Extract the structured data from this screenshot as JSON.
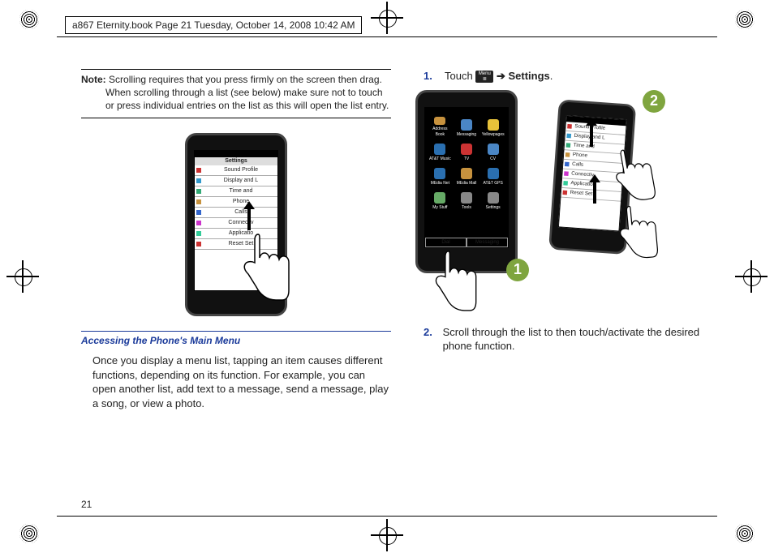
{
  "header": "a867 Eternity.book  Page 21  Tuesday, October 14, 2008  10:42 AM",
  "page_number": "21",
  "note": {
    "label": "Note:",
    "text": "Scrolling requires that you press firmly on the screen then drag. When scrolling through a list (see below) make sure not to touch or press individual entries on the list as this will open the list entry."
  },
  "fig1_phone": {
    "title": "Settings",
    "rows": [
      "Sound Profile",
      "Display and L",
      "Time and",
      "Phone",
      "Calls",
      "Connectiv",
      "Applicatio",
      "Reset Set"
    ]
  },
  "heading": "Accessing the Phone's Main Menu",
  "paragraph": "Once you display a menu list, tapping an item causes different functions, depending on its function. For example, you can open another list, add text to a message, send a message, play a song, or view a photo.",
  "steps": {
    "s1": {
      "num": "1.",
      "pre": "Touch",
      "icon_label": "Menu",
      "arrow": "➔",
      "target": "Settings",
      "tail": "."
    },
    "s2": {
      "num": "2.",
      "text": "Scroll through the list to then touch/activate the desired phone function."
    }
  },
  "fig2_apps": {
    "left": [
      "Address Book",
      "Messaging",
      "Yellowpages",
      "AT&T Music",
      "TV",
      "CV",
      "MEdia Net",
      "MEdia Mall",
      "AT&T GPS",
      "My Stuff",
      "Tools",
      "Settings"
    ],
    "left_bottom": [
      "Dial",
      "Messaging"
    ],
    "colors": [
      "#c7923e",
      "#4a86c5",
      "#e7c23a",
      "#2a6fb0",
      "#c33",
      "#4a86c5",
      "#2a6fb0",
      "#c7923e",
      "#2a6fb0",
      "#6a6",
      "#888",
      "#888"
    ]
  },
  "callouts": {
    "c1": "1",
    "c2": "2"
  }
}
